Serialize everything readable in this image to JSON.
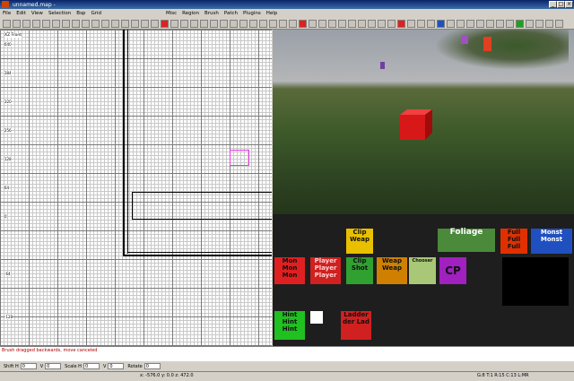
{
  "window": {
    "title": "unnamed.map - "
  },
  "menu": [
    "File",
    "Edit",
    "View",
    "Selection",
    "Bsp",
    "Grid",
    "Misc",
    "Region",
    "Brush",
    "Patch",
    "Plugins",
    "Help"
  ],
  "view2d": {
    "label": "XZ Front",
    "rulers": [
      "640",
      "384",
      "320",
      "256",
      "128",
      "64",
      "0",
      "-64",
      "-128"
    ]
  },
  "textures": [
    {
      "label": "Clip Weap",
      "bg": "#e8c000"
    },
    {
      "label": "Foliage",
      "bg": "#4a8a3a"
    },
    {
      "label": "Full Full Full",
      "bg": "#e03000"
    },
    {
      "label": "Monst Monst",
      "bg": "#2050c0"
    },
    {
      "label": "Mon Mon Mon",
      "bg": "#e02020"
    },
    {
      "label": "Player Player Player",
      "bg": "#d02020"
    },
    {
      "label": "Clip Shot",
      "bg": "#30a030"
    },
    {
      "label": "Weap Weap",
      "bg": "#d08000"
    },
    {
      "label": "Chooser",
      "bg": "#a8c878"
    },
    {
      "label": "CP",
      "bg": "#a020c0"
    },
    {
      "label": "Hint Hint Hint",
      "bg": "#20c020"
    },
    {
      "label": "Ladder der Lad",
      "bg": "#d02020"
    }
  ],
  "console": {
    "message": "Brush dragged backwards, move canceled"
  },
  "fields": [
    {
      "label": "Shift H",
      "value": "0"
    },
    {
      "label": "V",
      "value": "0"
    },
    {
      "label": "Scale H",
      "value": "0"
    },
    {
      "label": "V",
      "value": "0"
    },
    {
      "label": "Rotate",
      "value": "0"
    }
  ],
  "status": {
    "coords": "x: -576.0  y: 0.0  z: 472.0",
    "grid": "G:8  T:1  R:15  C:13  L:MR"
  }
}
